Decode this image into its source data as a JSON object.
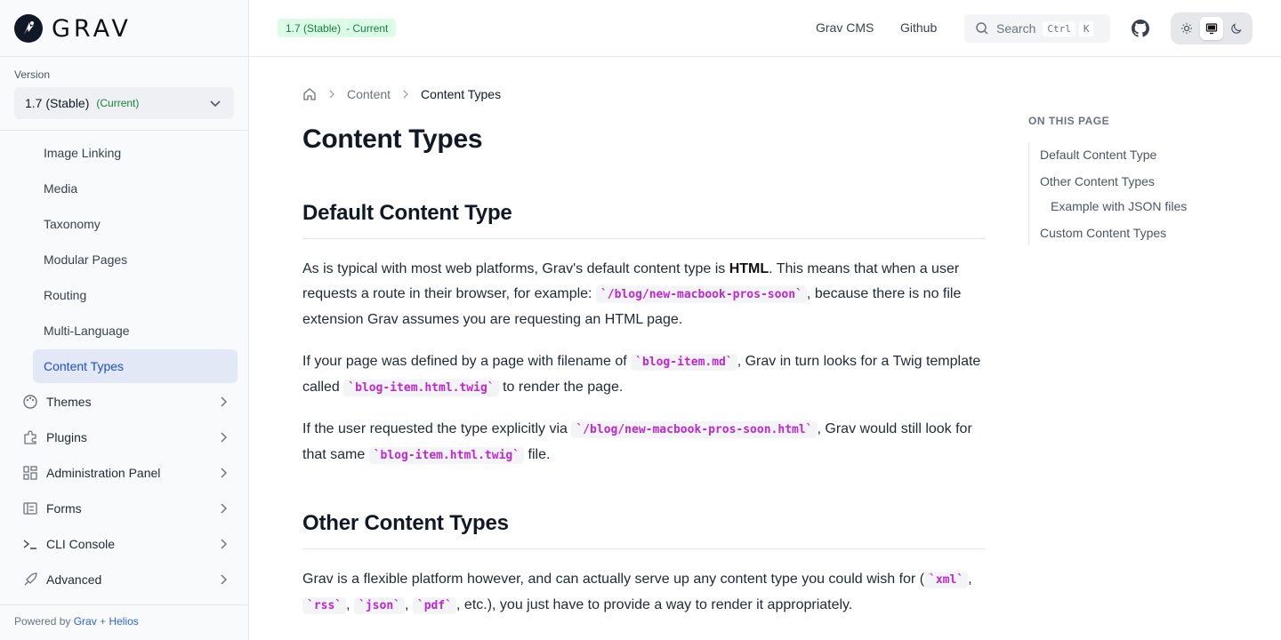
{
  "sidebar": {
    "logo_text": "GRAV",
    "version_label": "Version",
    "version_value": "1.7 (Stable)",
    "version_current": "(Current)",
    "sub_items": [
      {
        "label": "Image Linking"
      },
      {
        "label": "Media"
      },
      {
        "label": "Taxonomy"
      },
      {
        "label": "Modular Pages"
      },
      {
        "label": "Routing"
      },
      {
        "label": "Multi-Language"
      },
      {
        "label": "Content Types",
        "active": true
      }
    ],
    "sections": [
      {
        "label": "Themes",
        "icon": "palette-icon"
      },
      {
        "label": "Plugins",
        "icon": "puzzle-icon"
      },
      {
        "label": "Administration Panel",
        "icon": "dashboard-icon"
      },
      {
        "label": "Forms",
        "icon": "form-icon"
      },
      {
        "label": "CLI Console",
        "icon": "terminal-icon"
      },
      {
        "label": "Advanced",
        "icon": "rocket-icon"
      }
    ],
    "powered_prefix": "Powered by",
    "powered_grav": "Grav",
    "powered_plus": "+",
    "powered_helios": "Helios"
  },
  "header": {
    "badge_version": "1.7 (Stable)",
    "badge_current": "- Current",
    "link_cms": "Grav CMS",
    "link_github": "Github",
    "search_placeholder": "Search",
    "search_kbd_ctrl": "Ctrl",
    "search_kbd_k": "K",
    "theme_modes": [
      "light",
      "system",
      "dark"
    ],
    "theme_selected": "system"
  },
  "breadcrumb": {
    "items": [
      "Content",
      "Content Types"
    ]
  },
  "page": {
    "title": "Content Types",
    "h2_default": "Default Content Type",
    "p1_a": "As is typical with most web platforms, Grav's default content type is ",
    "p1_strong": "HTML",
    "p1_b": ". This means that when a user requests a route in their browser, for example: ",
    "p1_code": "`/blog/new-macbook-pros-soon`",
    "p1_c": ", because there is no file extension Grav assumes you are requesting an HTML page.",
    "p2_a": "If your page was defined by a page with filename of ",
    "p2_code1": "`blog-item.md`",
    "p2_b": ", Grav in turn looks for a Twig template called ",
    "p2_code2": "`blog-item.html.twig`",
    "p2_c": " to render the page.",
    "p3_a": "If the user requested the type explicitly via ",
    "p3_code1": "`/blog/new-macbook-pros-soon.html`",
    "p3_b": ", Grav would still look for that same ",
    "p3_code2": "`blog-item.html.twig`",
    "p3_c": " file.",
    "h2_other": "Other Content Types",
    "p4_a": "Grav is a flexible platform however, and can actually serve up any content type you could wish for (",
    "p4_code1": "`xml`",
    "p4_sep1": ", ",
    "p4_code2": "`rss`",
    "p4_sep2": ", ",
    "p4_code3": "`json`",
    "p4_sep3": ", ",
    "p4_code4": "`pdf`",
    "p4_b": ", etc.), you just have to provide a way to render it appropriately."
  },
  "toc": {
    "title": "ON THIS PAGE",
    "items": [
      {
        "label": "Default Content Type"
      },
      {
        "label": "Other Content Types"
      },
      {
        "label": "Example with JSON files"
      },
      {
        "label": "Custom Content Types"
      }
    ]
  },
  "colors": {
    "accent": "#1d4ed8",
    "badge_bg": "#dcfce7",
    "badge_text": "#15803d",
    "code_text": "#c026d3"
  }
}
